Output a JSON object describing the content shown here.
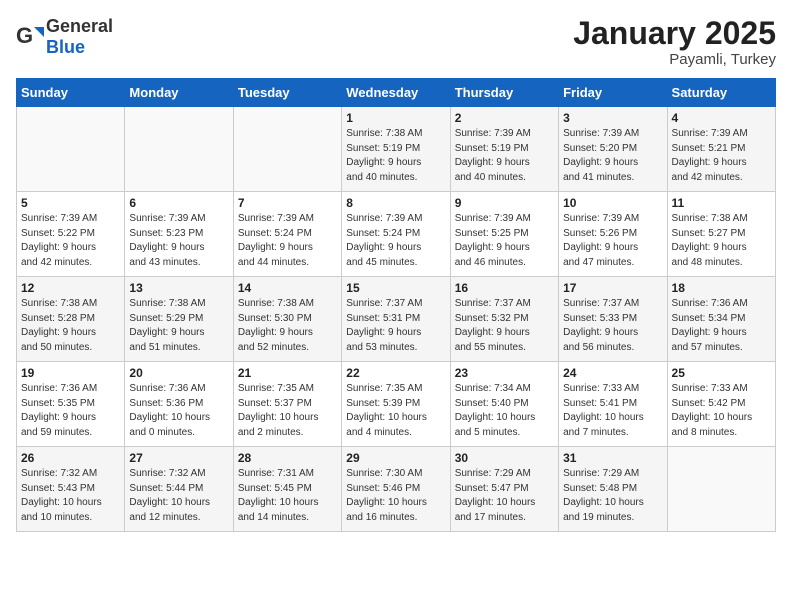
{
  "header": {
    "logo_general": "General",
    "logo_blue": "Blue",
    "month_title": "January 2025",
    "location": "Payamli, Turkey"
  },
  "weekdays": [
    "Sunday",
    "Monday",
    "Tuesday",
    "Wednesday",
    "Thursday",
    "Friday",
    "Saturday"
  ],
  "weeks": [
    [
      {
        "day": "",
        "info": ""
      },
      {
        "day": "",
        "info": ""
      },
      {
        "day": "",
        "info": ""
      },
      {
        "day": "1",
        "info": "Sunrise: 7:38 AM\nSunset: 5:19 PM\nDaylight: 9 hours\nand 40 minutes."
      },
      {
        "day": "2",
        "info": "Sunrise: 7:39 AM\nSunset: 5:19 PM\nDaylight: 9 hours\nand 40 minutes."
      },
      {
        "day": "3",
        "info": "Sunrise: 7:39 AM\nSunset: 5:20 PM\nDaylight: 9 hours\nand 41 minutes."
      },
      {
        "day": "4",
        "info": "Sunrise: 7:39 AM\nSunset: 5:21 PM\nDaylight: 9 hours\nand 42 minutes."
      }
    ],
    [
      {
        "day": "5",
        "info": "Sunrise: 7:39 AM\nSunset: 5:22 PM\nDaylight: 9 hours\nand 42 minutes."
      },
      {
        "day": "6",
        "info": "Sunrise: 7:39 AM\nSunset: 5:23 PM\nDaylight: 9 hours\nand 43 minutes."
      },
      {
        "day": "7",
        "info": "Sunrise: 7:39 AM\nSunset: 5:24 PM\nDaylight: 9 hours\nand 44 minutes."
      },
      {
        "day": "8",
        "info": "Sunrise: 7:39 AM\nSunset: 5:24 PM\nDaylight: 9 hours\nand 45 minutes."
      },
      {
        "day": "9",
        "info": "Sunrise: 7:39 AM\nSunset: 5:25 PM\nDaylight: 9 hours\nand 46 minutes."
      },
      {
        "day": "10",
        "info": "Sunrise: 7:39 AM\nSunset: 5:26 PM\nDaylight: 9 hours\nand 47 minutes."
      },
      {
        "day": "11",
        "info": "Sunrise: 7:38 AM\nSunset: 5:27 PM\nDaylight: 9 hours\nand 48 minutes."
      }
    ],
    [
      {
        "day": "12",
        "info": "Sunrise: 7:38 AM\nSunset: 5:28 PM\nDaylight: 9 hours\nand 50 minutes."
      },
      {
        "day": "13",
        "info": "Sunrise: 7:38 AM\nSunset: 5:29 PM\nDaylight: 9 hours\nand 51 minutes."
      },
      {
        "day": "14",
        "info": "Sunrise: 7:38 AM\nSunset: 5:30 PM\nDaylight: 9 hours\nand 52 minutes."
      },
      {
        "day": "15",
        "info": "Sunrise: 7:37 AM\nSunset: 5:31 PM\nDaylight: 9 hours\nand 53 minutes."
      },
      {
        "day": "16",
        "info": "Sunrise: 7:37 AM\nSunset: 5:32 PM\nDaylight: 9 hours\nand 55 minutes."
      },
      {
        "day": "17",
        "info": "Sunrise: 7:37 AM\nSunset: 5:33 PM\nDaylight: 9 hours\nand 56 minutes."
      },
      {
        "day": "18",
        "info": "Sunrise: 7:36 AM\nSunset: 5:34 PM\nDaylight: 9 hours\nand 57 minutes."
      }
    ],
    [
      {
        "day": "19",
        "info": "Sunrise: 7:36 AM\nSunset: 5:35 PM\nDaylight: 9 hours\nand 59 minutes."
      },
      {
        "day": "20",
        "info": "Sunrise: 7:36 AM\nSunset: 5:36 PM\nDaylight: 10 hours\nand 0 minutes."
      },
      {
        "day": "21",
        "info": "Sunrise: 7:35 AM\nSunset: 5:37 PM\nDaylight: 10 hours\nand 2 minutes."
      },
      {
        "day": "22",
        "info": "Sunrise: 7:35 AM\nSunset: 5:39 PM\nDaylight: 10 hours\nand 4 minutes."
      },
      {
        "day": "23",
        "info": "Sunrise: 7:34 AM\nSunset: 5:40 PM\nDaylight: 10 hours\nand 5 minutes."
      },
      {
        "day": "24",
        "info": "Sunrise: 7:33 AM\nSunset: 5:41 PM\nDaylight: 10 hours\nand 7 minutes."
      },
      {
        "day": "25",
        "info": "Sunrise: 7:33 AM\nSunset: 5:42 PM\nDaylight: 10 hours\nand 8 minutes."
      }
    ],
    [
      {
        "day": "26",
        "info": "Sunrise: 7:32 AM\nSunset: 5:43 PM\nDaylight: 10 hours\nand 10 minutes."
      },
      {
        "day": "27",
        "info": "Sunrise: 7:32 AM\nSunset: 5:44 PM\nDaylight: 10 hours\nand 12 minutes."
      },
      {
        "day": "28",
        "info": "Sunrise: 7:31 AM\nSunset: 5:45 PM\nDaylight: 10 hours\nand 14 minutes."
      },
      {
        "day": "29",
        "info": "Sunrise: 7:30 AM\nSunset: 5:46 PM\nDaylight: 10 hours\nand 16 minutes."
      },
      {
        "day": "30",
        "info": "Sunrise: 7:29 AM\nSunset: 5:47 PM\nDaylight: 10 hours\nand 17 minutes."
      },
      {
        "day": "31",
        "info": "Sunrise: 7:29 AM\nSunset: 5:48 PM\nDaylight: 10 hours\nand 19 minutes."
      },
      {
        "day": "",
        "info": ""
      }
    ]
  ]
}
